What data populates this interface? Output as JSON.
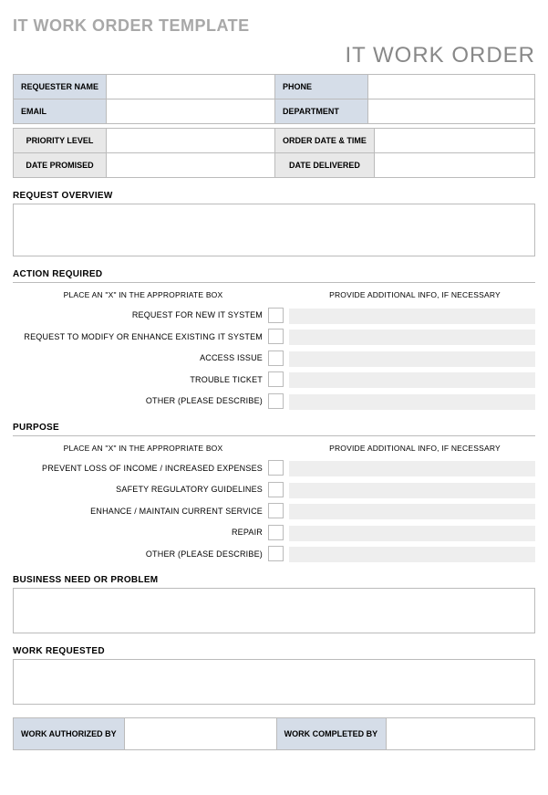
{
  "page_title": "IT WORK ORDER TEMPLATE",
  "sub_title": "IT WORK ORDER",
  "contact": {
    "requester_name_label": "REQUESTER NAME",
    "phone_label": "PHONE",
    "email_label": "EMAIL",
    "department_label": "DEPARTMENT"
  },
  "meta": {
    "priority_label": "PRIORITY LEVEL",
    "order_date_label": "ORDER DATE & TIME",
    "date_promised_label": "DATE PROMISED",
    "date_delivered_label": "DATE DELIVERED"
  },
  "sections": {
    "request_overview": "REQUEST OVERVIEW",
    "action_required": "ACTION REQUIRED",
    "purpose": "PURPOSE",
    "business_need": "BUSINESS NEED OR PROBLEM",
    "work_requested": "WORK REQUESTED"
  },
  "instructions": {
    "left": "PLACE AN \"X\" IN THE APPROPRIATE BOX",
    "right": "PROVIDE ADDITIONAL INFO, IF NECESSARY"
  },
  "action_items": [
    "REQUEST FOR NEW IT SYSTEM",
    "REQUEST TO MODIFY OR ENHANCE EXISTING IT SYSTEM",
    "ACCESS ISSUE",
    "TROUBLE TICKET",
    "OTHER (PLEASE DESCRIBE)"
  ],
  "purpose_items": [
    "PREVENT LOSS OF INCOME / INCREASED EXPENSES",
    "SAFETY REGULATORY GUIDELINES",
    "ENHANCE / MAINTAIN CURRENT SERVICE",
    "REPAIR",
    "OTHER (PLEASE DESCRIBE)"
  ],
  "signatures": {
    "authorized_label": "WORK AUTHORIZED BY",
    "completed_label": "WORK COMPLETED BY"
  }
}
